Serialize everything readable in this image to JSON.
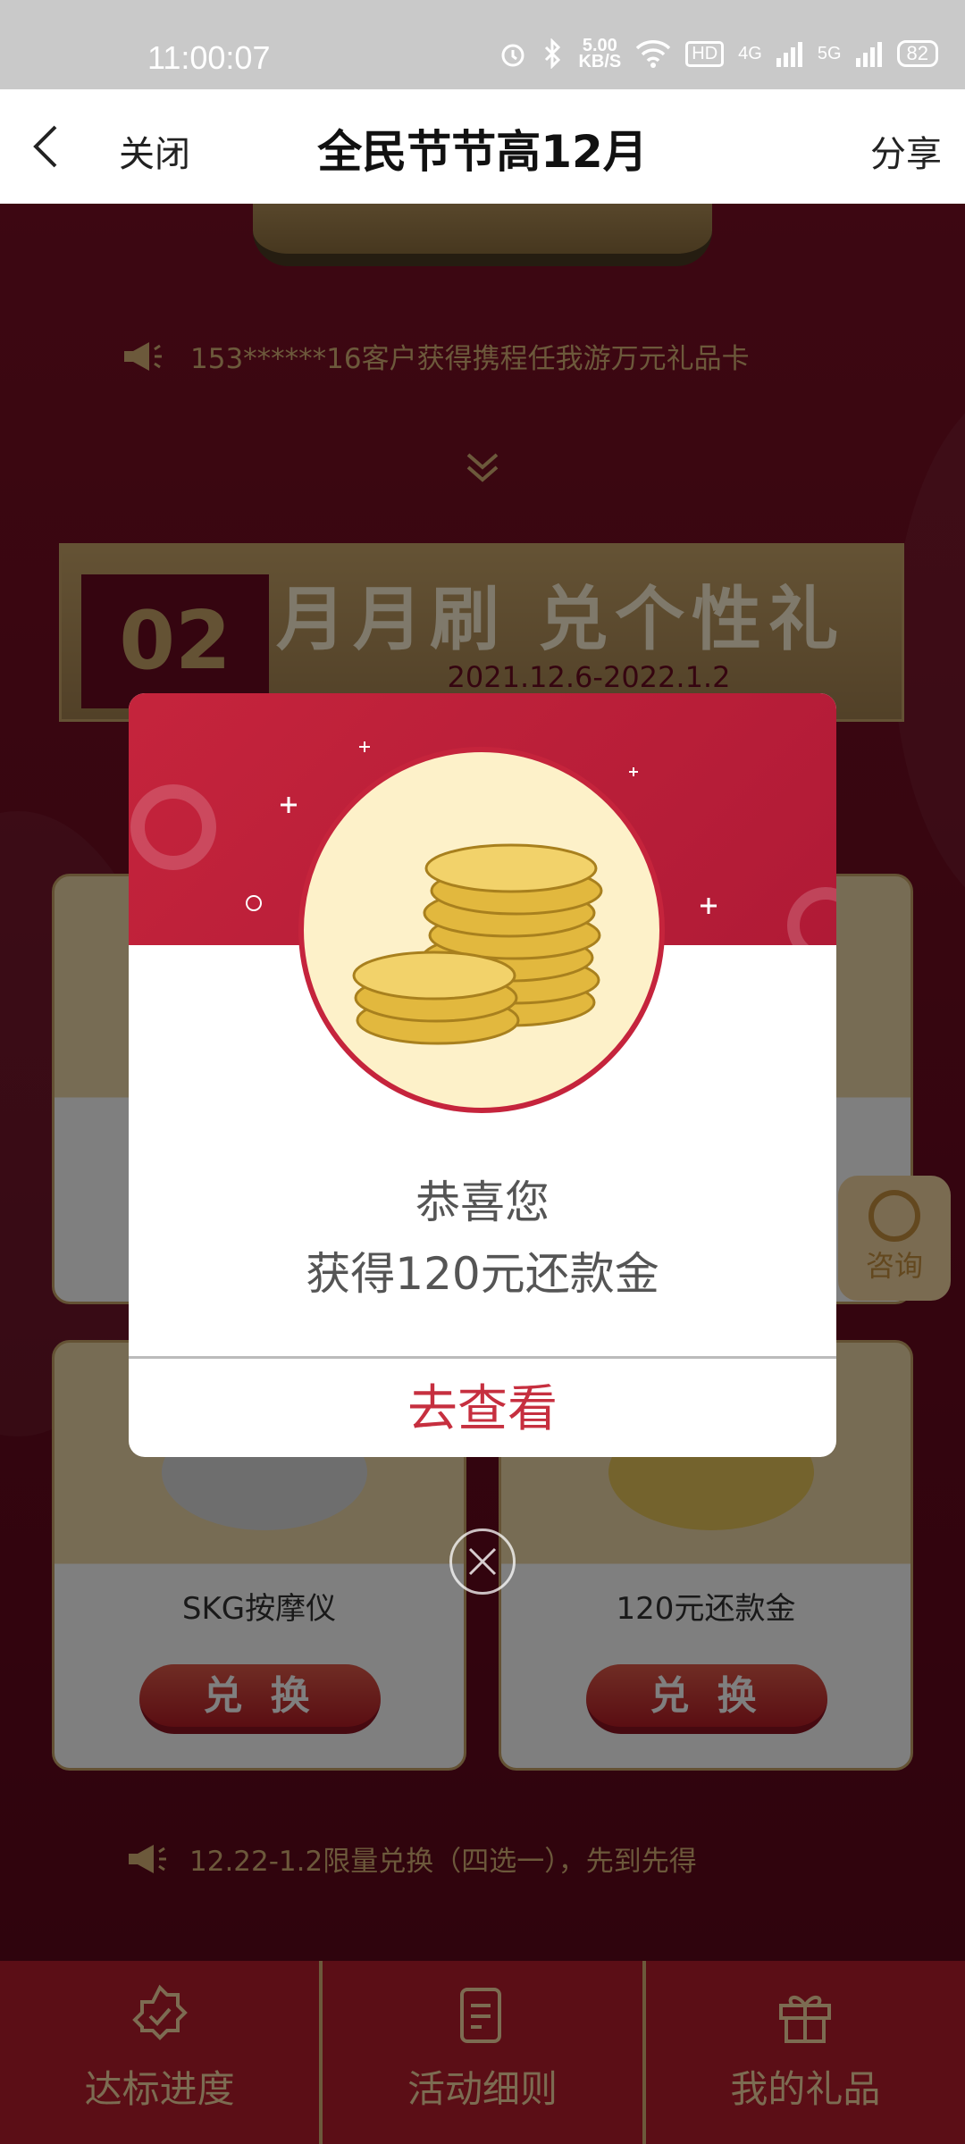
{
  "status_bar": {
    "time": "11:00:07",
    "net_speed_value": "5.00",
    "net_speed_unit": "KB/S",
    "hd_badge": "HD",
    "signal_1": "4G",
    "signal_2": "5G",
    "battery": "82",
    "icons": [
      "alarm-icon",
      "bluetooth-icon",
      "wifi-icon",
      "hd-icon",
      "signal-icon",
      "battery-icon"
    ]
  },
  "nav": {
    "close_label": "关闭",
    "title": "全民节节高12月",
    "share_label": "分享"
  },
  "page": {
    "ticker_text": "153******16客户获得携程任我游万元礼品卡",
    "banner_number": "02",
    "banner_title": "月月刷 兑个性礼",
    "banner_date": "2021.12.6-2022.1.2",
    "cards": [
      {
        "name": "SKG按摩仪",
        "button": "兑 换"
      },
      {
        "name": "120元还款金",
        "button": "兑 换"
      }
    ],
    "consult_label": "咨询",
    "notice_text": "12.22-1.2限量兑换（四选一），先到先得"
  },
  "tabs": [
    {
      "label": "达标进度",
      "icon": "badge-check-icon"
    },
    {
      "label": "活动细则",
      "icon": "document-icon"
    },
    {
      "label": "我的礼品",
      "icon": "gift-icon"
    }
  ],
  "dialog": {
    "line1": "恭喜您",
    "line2": "获得120元还款金",
    "cta": "去查看"
  },
  "colors": {
    "brand_red": "#c5243c",
    "gold": "#d9b277",
    "cta_red": "#c62f3f"
  }
}
